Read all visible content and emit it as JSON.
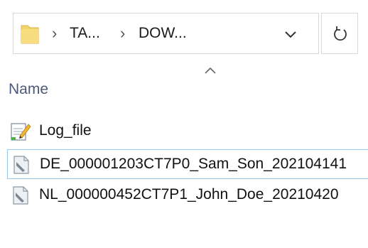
{
  "address_bar": {
    "breadcrumbs": [
      "TA...",
      "DOW..."
    ],
    "separator": "›",
    "icons": {
      "location": "folder-icon",
      "dropdown": "chevron-down-icon",
      "refresh": "refresh-icon"
    }
  },
  "file_list": {
    "sort_indicator_icon": "sort-ascending-caret-icon",
    "columns": {
      "name": "Name"
    },
    "items": [
      {
        "label": "Log_file",
        "icon": "text-document-icon"
      },
      {
        "label": "DE_000001203CT7P0_Sam_Son_202104141",
        "icon": "generic-file-icon"
      },
      {
        "label": "NL_000000452CT7P1_John_Doe_20210420",
        "icon": "generic-file-icon"
      }
    ]
  },
  "colors": {
    "selection_border": "#99c9ef",
    "folder_yellow": "#f5d36b",
    "header_text": "#4a5a7a"
  }
}
